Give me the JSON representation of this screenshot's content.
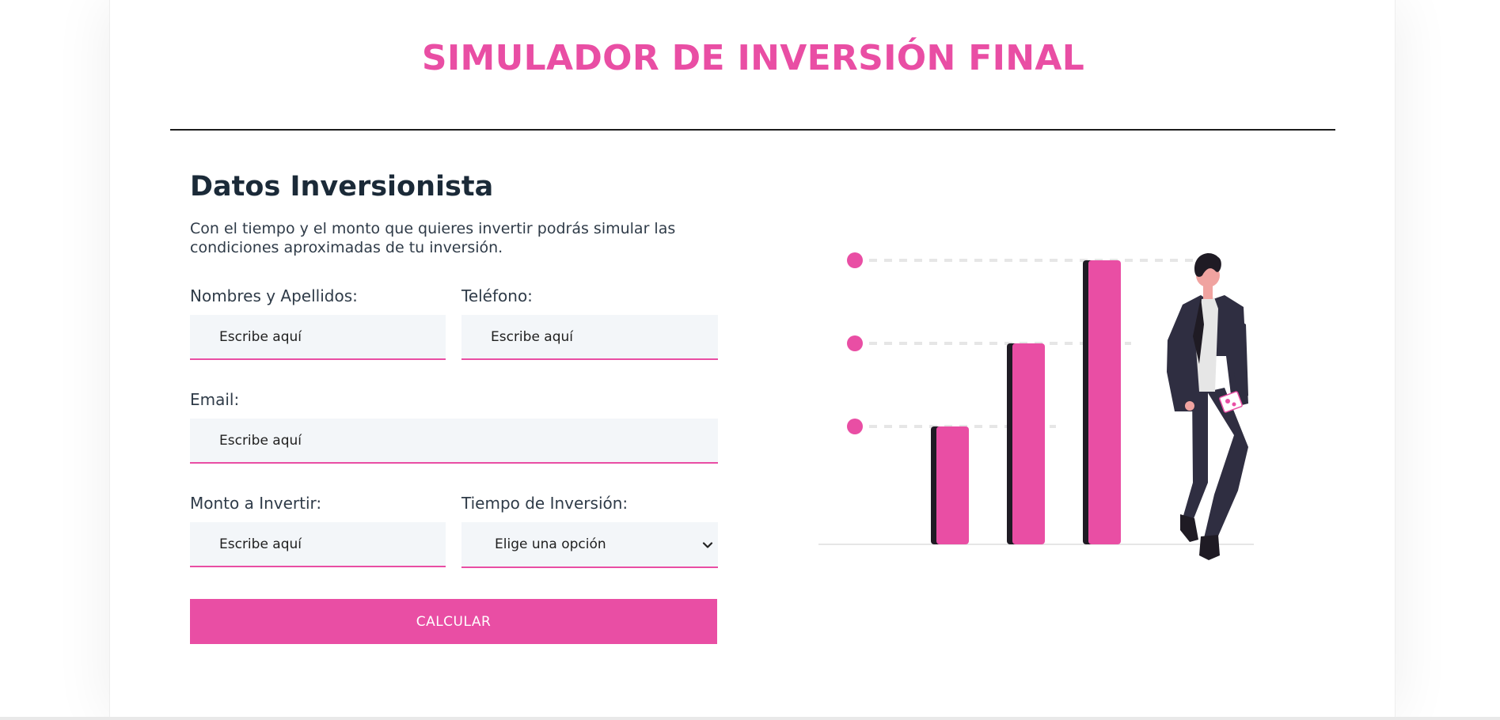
{
  "header": {
    "title": "SIMULADOR DE INVERSIÓN FINAL"
  },
  "form": {
    "section_title": "Datos Inversionista",
    "description": "Con el tiempo y el monto que quieres invertir podrás simular las condiciones aproximadas de tu inversión.",
    "fields": {
      "nombres": {
        "label": "Nombres y Apellidos:",
        "placeholder": "Escribe aquí"
      },
      "telefono": {
        "label": "Teléfono:",
        "placeholder": "Escribe aquí"
      },
      "email": {
        "label": "Email:",
        "placeholder": "Escribe aquí"
      },
      "monto": {
        "label": "Monto a Invertir:",
        "placeholder": "Escribe aquí"
      },
      "tiempo": {
        "label": "Tiempo de Inversión:",
        "selected": "Elige una opción"
      }
    },
    "submit_label": "CALCULAR"
  },
  "illustration": {
    "name": "investor-bar-chart-illustration",
    "bar_levels": [
      0.45,
      0.71,
      1.0
    ]
  },
  "colors": {
    "accent": "#e94ea4",
    "heading": "#1b2a38",
    "input_bg": "#f3f6f9",
    "suit": "#2f2e41"
  }
}
